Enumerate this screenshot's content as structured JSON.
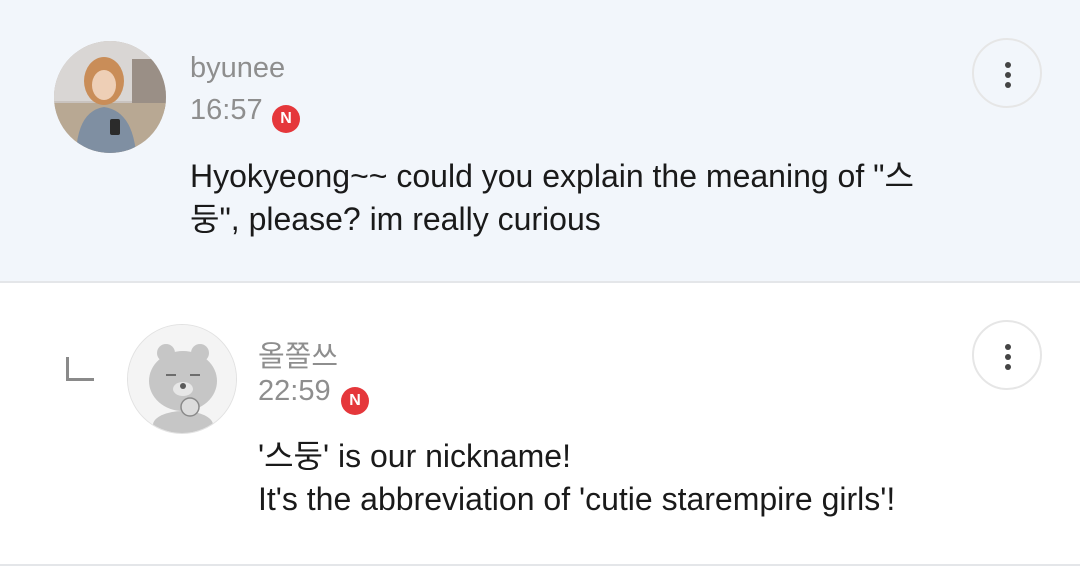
{
  "comments": [
    {
      "username": "byunee",
      "time": "16:57",
      "badge": "N",
      "text": "Hyokyeong~~ could you explain the meaning of \"스\n둥\", please? im really curious",
      "more_icon": "more-vert-icon",
      "avatar_icon": "user-photo-avatar"
    },
    {
      "username": "올쫄쓰",
      "time": "22:59",
      "badge": "N",
      "text": "'스둥' is our nickname!\nIt's the abbreviation of 'cutie starempire girls'!",
      "more_icon": "more-vert-icon",
      "avatar_icon": "bear-character-avatar",
      "reply_icon": "reply-indent-icon"
    }
  ],
  "colors": {
    "highlight_bg": "#f2f6fb",
    "badge": "#e5373b",
    "meta_text": "#8e8e8e",
    "body_text": "#1a1a1a"
  }
}
